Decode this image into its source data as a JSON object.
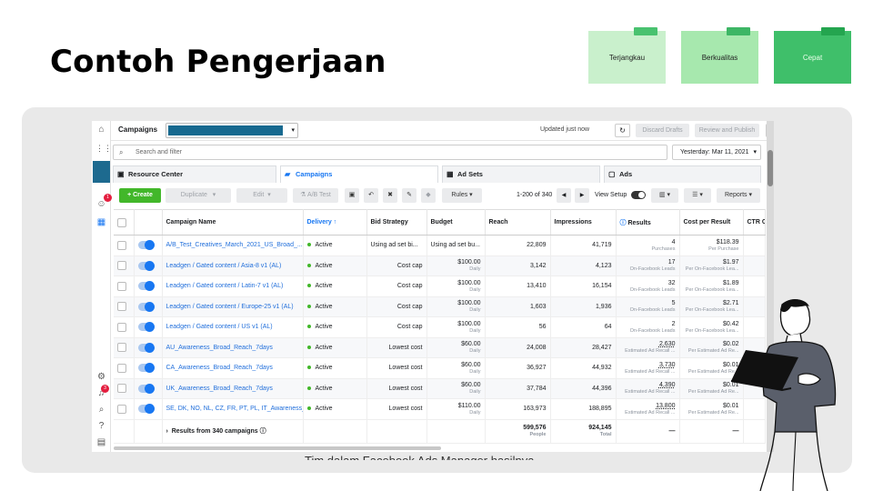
{
  "slide": {
    "title": "Contoh Pengerjaan",
    "notes": [
      "Terjangkau",
      "Berkualitas",
      "Cepat"
    ],
    "caption": "Tim dalam Facebook Ads Manager hasilnya"
  },
  "app": {
    "page_label": "Campaigns",
    "status": "Updated just now",
    "discard_label": "Discard Drafts",
    "review_label": "Review and Publish",
    "more_label": "···",
    "search_placeholder": "Search and filter",
    "date_range": "Yesterday: Mar 11, 2021",
    "tabs": [
      "Resource Center",
      "Campaigns",
      "Ad Sets",
      "Ads"
    ],
    "toolbar": {
      "create": "+ Create",
      "duplicate": "Duplicate",
      "edit": "Edit",
      "ab_test": "A/B Test",
      "rules": "Rules",
      "pagination": "1-200 of 340",
      "view_setup": "View Setup",
      "reports": "Reports"
    },
    "nav_badges": [
      "1",
      "3"
    ]
  },
  "table": {
    "headers": {
      "name": "Campaign Name",
      "delivery": "Delivery ↑",
      "bid": "Bid Strategy",
      "budget": "Budget",
      "reach": "Reach",
      "impressions": "Impressions",
      "results": "Results",
      "cpr": "Cost per Result",
      "ctr": "CTR Click Rate"
    },
    "rows": [
      {
        "name": "A/B_Test_Creatives_March_2021_US_Broad_...",
        "delivery": "Active",
        "bid": "Using ad set bi...",
        "budget": "Using ad set bu...",
        "budget_sub": "",
        "reach": "22,809",
        "impressions": "41,719",
        "results": "4",
        "results_sub": "Purchases",
        "cpr": "$118.39",
        "cpr_sub": "Per Purchase"
      },
      {
        "name": "Leadgen / Gated content / Asia-8 v1 (AL)",
        "delivery": "Active",
        "bid": "Cost cap",
        "budget": "$100.00",
        "budget_sub": "Daily",
        "reach": "3,142",
        "impressions": "4,123",
        "results": "17",
        "results_sub": "On-Facebook Leads",
        "cpr": "$1.97",
        "cpr_sub": "Per On-Facebook Lea..."
      },
      {
        "name": "Leadgen / Gated content / Latin-7 v1 (AL)",
        "delivery": "Active",
        "bid": "Cost cap",
        "budget": "$100.00",
        "budget_sub": "Daily",
        "reach": "13,410",
        "impressions": "16,154",
        "results": "32",
        "results_sub": "On-Facebook Leads",
        "cpr": "$1.89",
        "cpr_sub": "Per On-Facebook Lea..."
      },
      {
        "name": "Leadgen / Gated content / Europe-25 v1 (AL)",
        "delivery": "Active",
        "bid": "Cost cap",
        "budget": "$100.00",
        "budget_sub": "Daily",
        "reach": "1,603",
        "impressions": "1,936",
        "results": "5",
        "results_sub": "On-Facebook Leads",
        "cpr": "$2.71",
        "cpr_sub": "Per On-Facebook Lea..."
      },
      {
        "name": "Leadgen / Gated content / US v1 (AL)",
        "delivery": "Active",
        "bid": "Cost cap",
        "budget": "$100.00",
        "budget_sub": "Daily",
        "reach": "56",
        "impressions": "64",
        "results": "2",
        "results_sub": "On-Facebook Leads",
        "cpr": "$0.42",
        "cpr_sub": "Per On-Facebook Lea..."
      },
      {
        "name": "AU_Awareness_Broad_Reach_7days",
        "delivery": "Active",
        "bid": "Lowest cost",
        "budget": "$60.00",
        "budget_sub": "Daily",
        "reach": "24,008",
        "impressions": "28,427",
        "results": "2,630",
        "results_sub": "Estimated Ad Recall ...",
        "cpr": "$0.02",
        "cpr_sub": "Per Estimated Ad Re..."
      },
      {
        "name": "CA_Awareness_Broad_Reach_7days",
        "delivery": "Active",
        "bid": "Lowest cost",
        "budget": "$60.00",
        "budget_sub": "Daily",
        "reach": "36,927",
        "impressions": "44,932",
        "results": "3,730",
        "results_sub": "Estimated Ad Recall ...",
        "cpr": "$0.01",
        "cpr_sub": "Per Estimated Ad Re..."
      },
      {
        "name": "UK_Awareness_Broad_Reach_7days",
        "delivery": "Active",
        "bid": "Lowest cost",
        "budget": "$60.00",
        "budget_sub": "Daily",
        "reach": "37,784",
        "impressions": "44,396",
        "results": "4,390",
        "results_sub": "Estimated Ad Recall ...",
        "cpr": "$0.01",
        "cpr_sub": "Per Estimated Ad Re..."
      },
      {
        "name": "SE, DK, NO, NL, CZ, FR, PT, PL, IT_Awareness_...",
        "delivery": "Active",
        "bid": "Lowest cost",
        "budget": "$110.00",
        "budget_sub": "Daily",
        "reach": "163,973",
        "impressions": "188,895",
        "results": "13,800",
        "results_sub": "Estimated Ad Recall ...",
        "cpr": "$0.01",
        "cpr_sub": "Per Estimated Ad Re..."
      }
    ],
    "total": {
      "label": "Results from 340 campaigns",
      "reach": "599,576",
      "reach_sub": "People",
      "impressions": "924,145",
      "impressions_sub": "Total",
      "results": "—",
      "cpr": "—"
    }
  },
  "colors": {
    "accent": "#1877f2",
    "create_green": "#42b72a",
    "account_bar": "#17698f",
    "panel": "#e9e9e9"
  }
}
